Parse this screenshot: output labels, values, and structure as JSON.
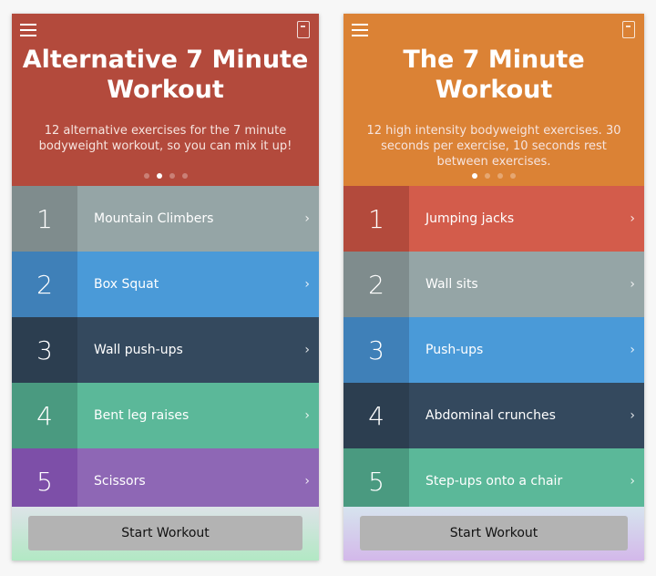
{
  "screens": [
    {
      "title": "Alternative 7 Minute Workout",
      "subtitle": "12 alternative exercises for the 7 minute bodyweight workout, so you can mix it up!",
      "header_color": "#B34A3C",
      "active_dot": 1,
      "items": [
        {
          "number": "1",
          "label": "Mountain Climbers",
          "color": "#95A5A6",
          "num_color": "#7F8C8D"
        },
        {
          "number": "2",
          "label": "Box Squat",
          "color": "#4A9AD8",
          "num_color": "#3F80B8"
        },
        {
          "number": "3",
          "label": "Wall push-ups",
          "color": "#34495E",
          "num_color": "#2C3E50"
        },
        {
          "number": "4",
          "label": "Bent leg raises",
          "color": "#5BB899",
          "num_color": "#4A9A80"
        },
        {
          "number": "5",
          "label": "Scissors",
          "color": "#8E67B5",
          "num_color": "#7D4FA8"
        }
      ],
      "footer_gradient": "linear-gradient(#dde3e8,#b2e8c4)",
      "start_label": "Start Workout"
    },
    {
      "title": "The 7 Minute Workout",
      "subtitle": "12 high intensity bodyweight exercises. 30 seconds per exercise, 10 seconds rest between exercises.",
      "header_color": "#DB8235",
      "active_dot": 0,
      "items": [
        {
          "number": "1",
          "label": "Jumping jacks",
          "color": "#D35C4B",
          "num_color": "#B34A3C"
        },
        {
          "number": "2",
          "label": "Wall sits",
          "color": "#95A5A6",
          "num_color": "#7F8C8D"
        },
        {
          "number": "3",
          "label": "Push-ups",
          "color": "#4A9AD8",
          "num_color": "#3F80B8"
        },
        {
          "number": "4",
          "label": "Abdominal crunches",
          "color": "#34495E",
          "num_color": "#2C3E50"
        },
        {
          "number": "5",
          "label": "Step-ups onto a chair",
          "color": "#5BB899",
          "num_color": "#4A9A80"
        }
      ],
      "footer_gradient": "linear-gradient(#d6e4ee,#d3b8ea)",
      "start_label": "Start Workout"
    }
  ]
}
